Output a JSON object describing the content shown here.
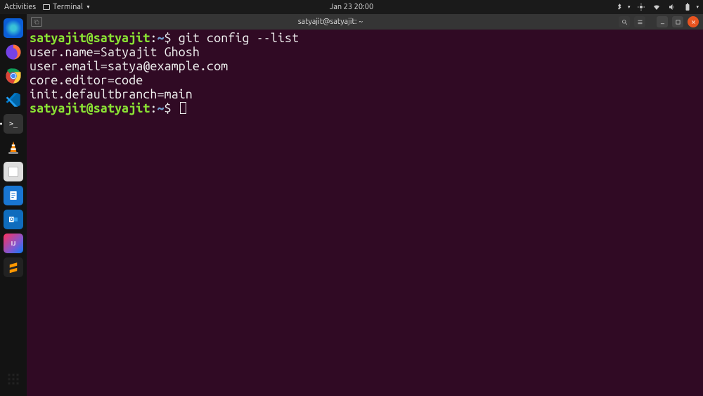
{
  "topbar": {
    "activities": "Activities",
    "appmenu": "Terminal",
    "clock": "Jan 23  20:00"
  },
  "dock": {
    "items": [
      {
        "name": "edge",
        "color": "#0b5ed7",
        "glyph": "e"
      },
      {
        "name": "firefox",
        "color": "#ff7139",
        "glyph": ""
      },
      {
        "name": "chrome",
        "color": "#fff",
        "glyph": ""
      },
      {
        "name": "vscode",
        "color": "#0065A9",
        "glyph": ""
      },
      {
        "name": "terminal",
        "color": "#2c2c2c",
        "glyph": ">_",
        "active": true
      },
      {
        "name": "vlc",
        "color": "#ff8800",
        "glyph": "▲"
      },
      {
        "name": "files",
        "color": "#eee",
        "glyph": ""
      },
      {
        "name": "libreoffice-writer",
        "color": "#1565c0",
        "glyph": ""
      },
      {
        "name": "outlook",
        "color": "#0f6cbd",
        "glyph": ""
      },
      {
        "name": "intellij",
        "color": "#3b2e5a",
        "glyph": "IJ"
      },
      {
        "name": "sublime",
        "color": "#333",
        "glyph": ""
      }
    ]
  },
  "window": {
    "title": "satyajit@satyajit: ~"
  },
  "terminal": {
    "prompt_user_host": "satyajit@satyajit",
    "prompt_path": "~",
    "command": "git config --list",
    "output": [
      "user.name=Satyajit Ghosh",
      "user.email=satya@example.com",
      "core.editor=code",
      "init.defaultbranch=main"
    ]
  }
}
